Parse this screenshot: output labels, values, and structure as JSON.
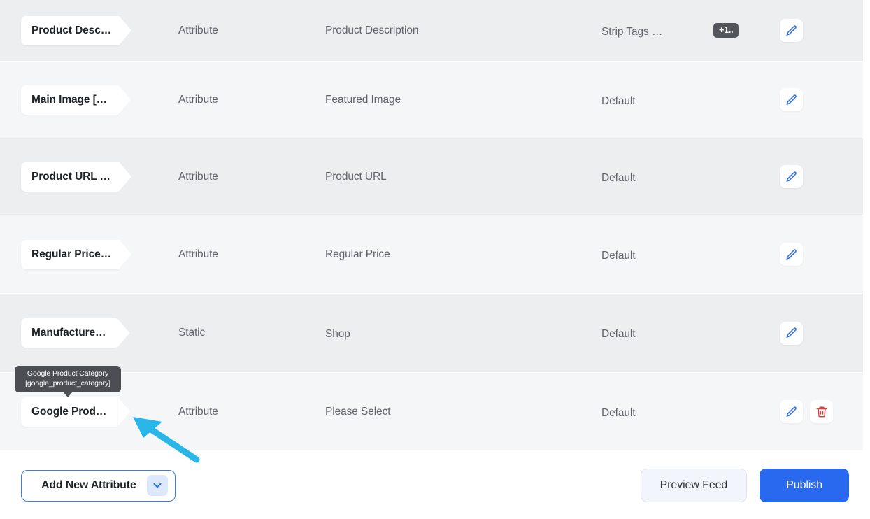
{
  "table": {
    "rows": [
      {
        "name": "Product Desc…",
        "type": "Attribute",
        "value": "Product Description",
        "modifier": "Strip Tags  …",
        "badge": "+1..",
        "actions": [
          "edit-icon"
        ]
      },
      {
        "name": "Main Image […",
        "type": "Attribute",
        "value": "Featured Image",
        "modifier": "Default",
        "badge": "",
        "actions": [
          "edit-icon"
        ]
      },
      {
        "name": "Product URL …",
        "type": "Attribute",
        "value": "Product URL",
        "modifier": "Default",
        "badge": "",
        "actions": [
          "edit-icon"
        ]
      },
      {
        "name": "Regular Price…",
        "type": "Attribute",
        "value": "Regular Price",
        "modifier": "Default",
        "badge": "",
        "actions": [
          "edit-icon"
        ]
      },
      {
        "name": "Manufacture…",
        "type": "Static",
        "value": "Shop",
        "modifier": "Default",
        "badge": "",
        "actions": [
          "edit-icon"
        ]
      },
      {
        "name": "Google Prod…",
        "type": "Attribute",
        "value": "Please Select",
        "modifier": "Default",
        "badge": "",
        "actions": [
          "edit-icon",
          "delete-icon"
        ]
      }
    ]
  },
  "tooltip": {
    "line1": "Google Product Category",
    "line2": "[google_product_category]"
  },
  "footer": {
    "add_new_attribute_label": "Add New Attribute",
    "add_new_attribute_chevron": "chevron-down-icon",
    "preview_feed_label": "Preview Feed",
    "publish_label": "Publish"
  },
  "colors": {
    "accent_blue": "#2969f0",
    "edit_icon_blue": "#2a6df0",
    "delete_icon_red": "#e0413c",
    "badge_gray": "#52555c",
    "tooltip_gray": "#4b4f54",
    "row_odd": "#edeef0",
    "row_even": "#f5f6f8",
    "annotation_cyan": "#29b6e8"
  },
  "annotation": {
    "arrow": "cyan-pointer-arrow"
  }
}
